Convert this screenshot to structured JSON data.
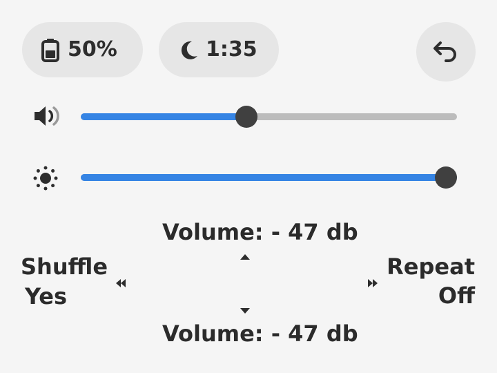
{
  "status": {
    "battery_text": "50%",
    "timer_text": "1:35",
    "battery_level": 0.5
  },
  "icons": {
    "battery": "battery-icon",
    "sleep_timer": "moon-icon",
    "back": "back-arrow-icon",
    "volume": "speaker-icon",
    "brightness": "sun-icon"
  },
  "sliders": {
    "volume_level": 0.44,
    "brightness_level": 1.0,
    "fill_color": "#3584e4",
    "track_color": "#bcbcbc",
    "knob_color": "#404040"
  },
  "controls": {
    "volume_up_label": "Volume: - 47 db",
    "volume_down_label": "Volume: - 47 db",
    "shuffle_label": "Shuffle",
    "shuffle_value": "Yes",
    "repeat_label": "Repeat",
    "repeat_value": "Off"
  }
}
